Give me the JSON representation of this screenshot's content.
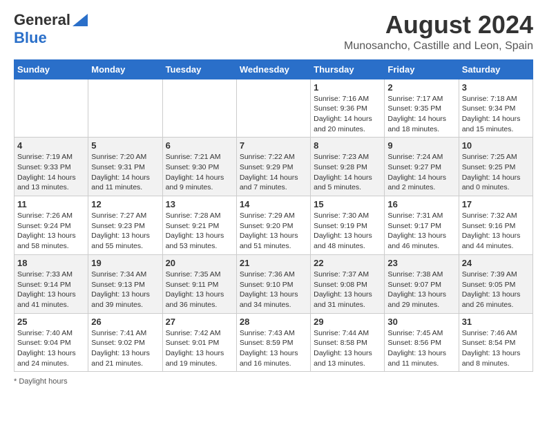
{
  "header": {
    "logo_general": "General",
    "logo_blue": "Blue",
    "title": "August 2024",
    "subtitle": "Munosancho, Castille and Leon, Spain"
  },
  "weekdays": [
    "Sunday",
    "Monday",
    "Tuesday",
    "Wednesday",
    "Thursday",
    "Friday",
    "Saturday"
  ],
  "weeks": [
    [
      {
        "day": "",
        "info": ""
      },
      {
        "day": "",
        "info": ""
      },
      {
        "day": "",
        "info": ""
      },
      {
        "day": "",
        "info": ""
      },
      {
        "day": "1",
        "info": "Sunrise: 7:16 AM\nSunset: 9:36 PM\nDaylight: 14 hours and 20 minutes."
      },
      {
        "day": "2",
        "info": "Sunrise: 7:17 AM\nSunset: 9:35 PM\nDaylight: 14 hours and 18 minutes."
      },
      {
        "day": "3",
        "info": "Sunrise: 7:18 AM\nSunset: 9:34 PM\nDaylight: 14 hours and 15 minutes."
      }
    ],
    [
      {
        "day": "4",
        "info": "Sunrise: 7:19 AM\nSunset: 9:33 PM\nDaylight: 14 hours and 13 minutes."
      },
      {
        "day": "5",
        "info": "Sunrise: 7:20 AM\nSunset: 9:31 PM\nDaylight: 14 hours and 11 minutes."
      },
      {
        "day": "6",
        "info": "Sunrise: 7:21 AM\nSunset: 9:30 PM\nDaylight: 14 hours and 9 minutes."
      },
      {
        "day": "7",
        "info": "Sunrise: 7:22 AM\nSunset: 9:29 PM\nDaylight: 14 hours and 7 minutes."
      },
      {
        "day": "8",
        "info": "Sunrise: 7:23 AM\nSunset: 9:28 PM\nDaylight: 14 hours and 5 minutes."
      },
      {
        "day": "9",
        "info": "Sunrise: 7:24 AM\nSunset: 9:27 PM\nDaylight: 14 hours and 2 minutes."
      },
      {
        "day": "10",
        "info": "Sunrise: 7:25 AM\nSunset: 9:25 PM\nDaylight: 14 hours and 0 minutes."
      }
    ],
    [
      {
        "day": "11",
        "info": "Sunrise: 7:26 AM\nSunset: 9:24 PM\nDaylight: 13 hours and 58 minutes."
      },
      {
        "day": "12",
        "info": "Sunrise: 7:27 AM\nSunset: 9:23 PM\nDaylight: 13 hours and 55 minutes."
      },
      {
        "day": "13",
        "info": "Sunrise: 7:28 AM\nSunset: 9:21 PM\nDaylight: 13 hours and 53 minutes."
      },
      {
        "day": "14",
        "info": "Sunrise: 7:29 AM\nSunset: 9:20 PM\nDaylight: 13 hours and 51 minutes."
      },
      {
        "day": "15",
        "info": "Sunrise: 7:30 AM\nSunset: 9:19 PM\nDaylight: 13 hours and 48 minutes."
      },
      {
        "day": "16",
        "info": "Sunrise: 7:31 AM\nSunset: 9:17 PM\nDaylight: 13 hours and 46 minutes."
      },
      {
        "day": "17",
        "info": "Sunrise: 7:32 AM\nSunset: 9:16 PM\nDaylight: 13 hours and 44 minutes."
      }
    ],
    [
      {
        "day": "18",
        "info": "Sunrise: 7:33 AM\nSunset: 9:14 PM\nDaylight: 13 hours and 41 minutes."
      },
      {
        "day": "19",
        "info": "Sunrise: 7:34 AM\nSunset: 9:13 PM\nDaylight: 13 hours and 39 minutes."
      },
      {
        "day": "20",
        "info": "Sunrise: 7:35 AM\nSunset: 9:11 PM\nDaylight: 13 hours and 36 minutes."
      },
      {
        "day": "21",
        "info": "Sunrise: 7:36 AM\nSunset: 9:10 PM\nDaylight: 13 hours and 34 minutes."
      },
      {
        "day": "22",
        "info": "Sunrise: 7:37 AM\nSunset: 9:08 PM\nDaylight: 13 hours and 31 minutes."
      },
      {
        "day": "23",
        "info": "Sunrise: 7:38 AM\nSunset: 9:07 PM\nDaylight: 13 hours and 29 minutes."
      },
      {
        "day": "24",
        "info": "Sunrise: 7:39 AM\nSunset: 9:05 PM\nDaylight: 13 hours and 26 minutes."
      }
    ],
    [
      {
        "day": "25",
        "info": "Sunrise: 7:40 AM\nSunset: 9:04 PM\nDaylight: 13 hours and 24 minutes."
      },
      {
        "day": "26",
        "info": "Sunrise: 7:41 AM\nSunset: 9:02 PM\nDaylight: 13 hours and 21 minutes."
      },
      {
        "day": "27",
        "info": "Sunrise: 7:42 AM\nSunset: 9:01 PM\nDaylight: 13 hours and 19 minutes."
      },
      {
        "day": "28",
        "info": "Sunrise: 7:43 AM\nSunset: 8:59 PM\nDaylight: 13 hours and 16 minutes."
      },
      {
        "day": "29",
        "info": "Sunrise: 7:44 AM\nSunset: 8:58 PM\nDaylight: 13 hours and 13 minutes."
      },
      {
        "day": "30",
        "info": "Sunrise: 7:45 AM\nSunset: 8:56 PM\nDaylight: 13 hours and 11 minutes."
      },
      {
        "day": "31",
        "info": "Sunrise: 7:46 AM\nSunset: 8:54 PM\nDaylight: 13 hours and 8 minutes."
      }
    ]
  ],
  "footer": {
    "daylight_label": "Daylight hours"
  }
}
